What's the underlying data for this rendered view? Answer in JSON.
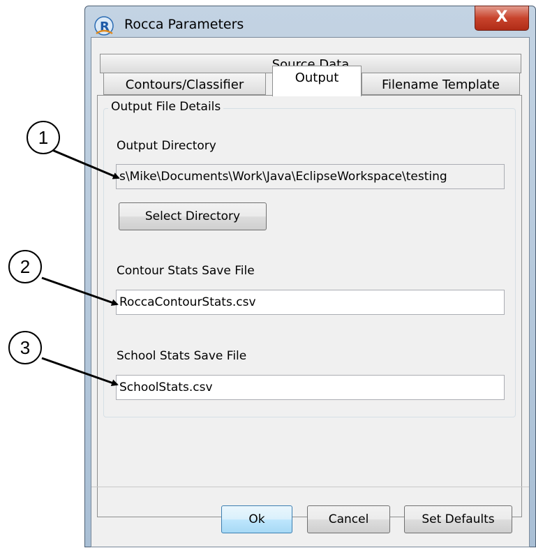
{
  "window": {
    "title": "Rocca Parameters",
    "close_glyph": "X"
  },
  "tabs": {
    "top_row": [
      "Source Data"
    ],
    "bottom_row": [
      "Contours/Classifier",
      "Output",
      "Filename Template"
    ],
    "active": "Output"
  },
  "panel": {
    "group_title": "Output File Details",
    "output_directory_label": "Output Directory",
    "output_directory_value": "s\\Mike\\Documents\\Work\\Java\\EclipseWorkspace\\testing",
    "select_directory_button": "Select Directory",
    "contour_stats_label": "Contour Stats Save File",
    "contour_stats_value": "RoccaContourStats.csv",
    "school_stats_label": "School Stats Save File",
    "school_stats_value": "SchoolStats.csv"
  },
  "footer": {
    "ok": "Ok",
    "cancel": "Cancel",
    "set_defaults": "Set Defaults"
  },
  "callouts": [
    "1",
    "2",
    "3"
  ],
  "icons": {
    "app": "rocca-r-icon",
    "close": "close-icon"
  }
}
